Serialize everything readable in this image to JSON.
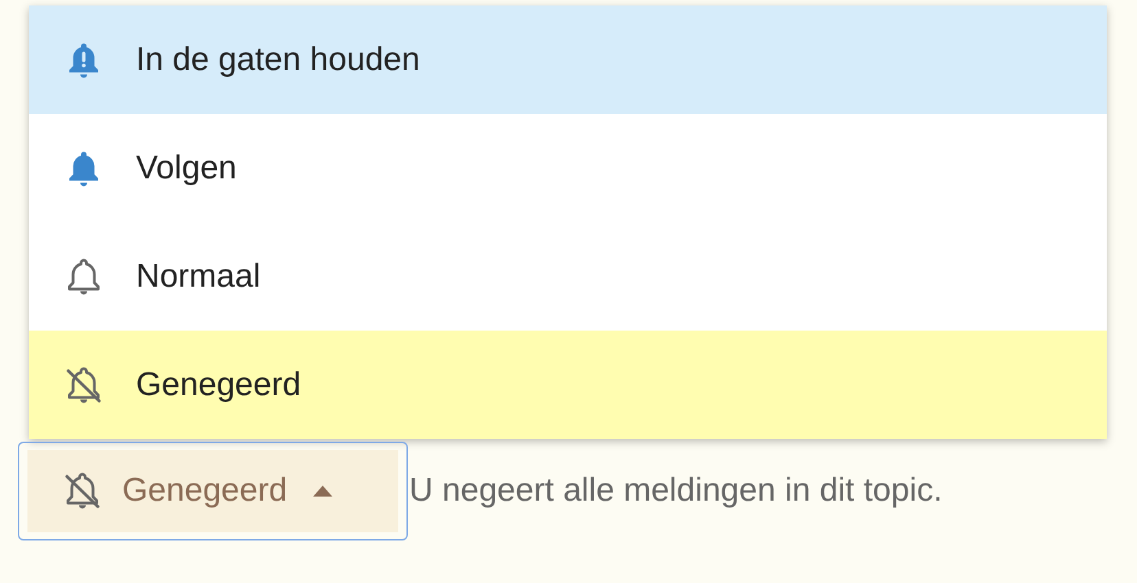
{
  "menu": {
    "items": [
      {
        "kind": "watching",
        "label": "In de gaten houden",
        "focused": true,
        "selected": false
      },
      {
        "kind": "tracking",
        "label": "Volgen",
        "focused": false,
        "selected": false
      },
      {
        "kind": "regular",
        "label": "Normaal",
        "focused": false,
        "selected": false
      },
      {
        "kind": "muted",
        "label": "Genegeerd",
        "focused": false,
        "selected": true
      }
    ]
  },
  "dropdown_button": {
    "kind": "muted",
    "label": "Genegeerd",
    "expanded": true,
    "focused": true
  },
  "description": "U negeert alle meldingen in dit topic."
}
